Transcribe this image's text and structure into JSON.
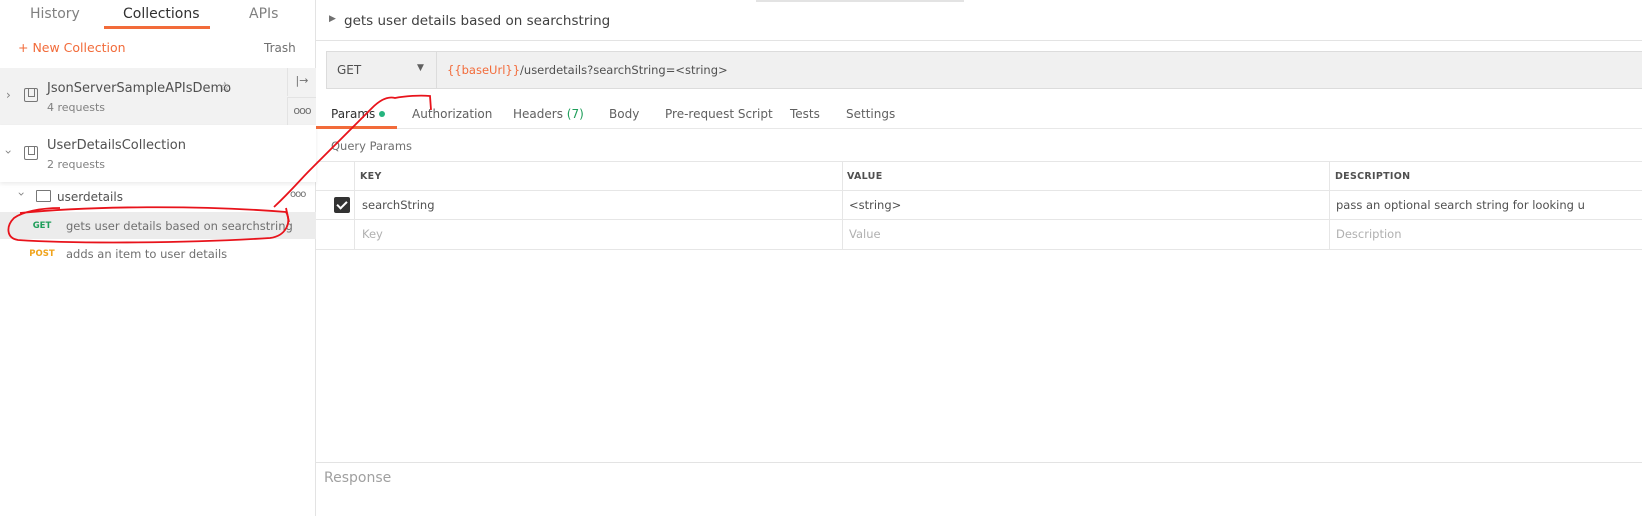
{
  "sidebar": {
    "tabs": [
      {
        "label": "History"
      },
      {
        "label": "Collections"
      },
      {
        "label": "APIs"
      }
    ],
    "new_collection": "+ New Collection",
    "trash": "Trash",
    "collections": [
      {
        "name": "JsonServerSampleAPIsDemo",
        "count": "4 requests",
        "starred": true
      },
      {
        "name": "UserDetailsCollection",
        "count": "2 requests"
      }
    ],
    "folder": {
      "name": "userdetails"
    },
    "requests": [
      {
        "method": "GET",
        "name": "gets user details based on searchstring",
        "color": "#1f9e5a"
      },
      {
        "method": "POST",
        "name": "adds an item to user details",
        "color": "#f0a31b"
      }
    ]
  },
  "request": {
    "title": "gets user details based on searchstring",
    "method": "GET",
    "url_var": "{{baseUrl}}",
    "url_rest": "/userdetails?searchString=<string>",
    "tabs": [
      {
        "label": "Params"
      },
      {
        "label": "Authorization"
      },
      {
        "label": "Headers",
        "count": "(7)"
      },
      {
        "label": "Body"
      },
      {
        "label": "Pre-request Script"
      },
      {
        "label": "Tests"
      },
      {
        "label": "Settings"
      }
    ],
    "query_params_label": "Query Params",
    "table": {
      "headers": [
        "KEY",
        "VALUE",
        "DESCRIPTION"
      ],
      "rows": [
        {
          "checked": true,
          "key": "searchString",
          "value": "<string>",
          "description": "pass an optional search string for looking u"
        }
      ],
      "placeholders": {
        "key": "Key",
        "value": "Value",
        "description": "Description"
      }
    }
  },
  "response": {
    "label": "Response"
  },
  "colors": {
    "accent": "#f26b3a",
    "annotation": "#e8131b"
  }
}
